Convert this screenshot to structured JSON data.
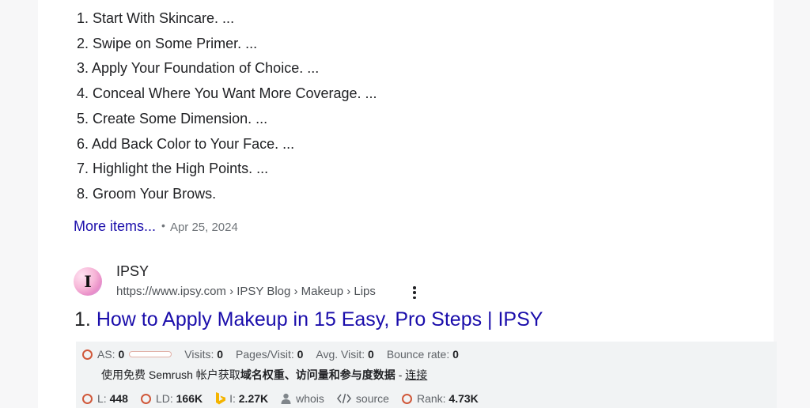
{
  "steps": [
    "1. Start With Skincare. ...",
    "2. Swipe on Some Primer. ...",
    "3. Apply Your Foundation of Choice. ...",
    "4. Conceal Where You Want More Coverage. ...",
    "5. Create Some Dimension. ...",
    "6. Add Back Color to Your Face. ...",
    "7. Highlight the High Points. ...",
    "8. Groom Your Brows."
  ],
  "more": {
    "link_label": "More items...",
    "separator": "•",
    "date": "Apr 25, 2024"
  },
  "result": {
    "favicon_letter": "I",
    "site_name": "IPSY",
    "breadcrumb": "https://www.ipsy.com › IPSY Blog › Makeup › Lips",
    "number": "1.",
    "title": "How to Apply Makeup in 15 Easy, Pro Steps | IPSY"
  },
  "seo": {
    "as_label": "AS:",
    "as_value": "0",
    "as_score": 0,
    "visits_label": "Visits:",
    "visits_value": "0",
    "pages_label": "Pages/Visit:",
    "pages_value": "0",
    "avg_label": "Avg. Visit:",
    "avg_value": "0",
    "bounce_label": "Bounce rate:",
    "bounce_value": "0",
    "promo_plain_1": "使用免费 Semrush 帐户获取",
    "promo_bold": "域名权重、访问量和参与度数据",
    "promo_dash": " - ",
    "promo_link": "连接",
    "l_label": "L:",
    "l_value": "448",
    "ld_label": "LD:",
    "ld_value": "166K",
    "i_label": "I:",
    "i_value": "2.27K",
    "whois_label": "whois",
    "source_label": "source",
    "rank_label": "Rank:",
    "rank_value": "4.73K",
    "ring_color": "#d0583a",
    "bing_color": "#f4b400"
  },
  "colors": {
    "link": "#1a0dab",
    "text": "#202124",
    "muted": "#70757a",
    "panel": "#f1f3f4"
  }
}
